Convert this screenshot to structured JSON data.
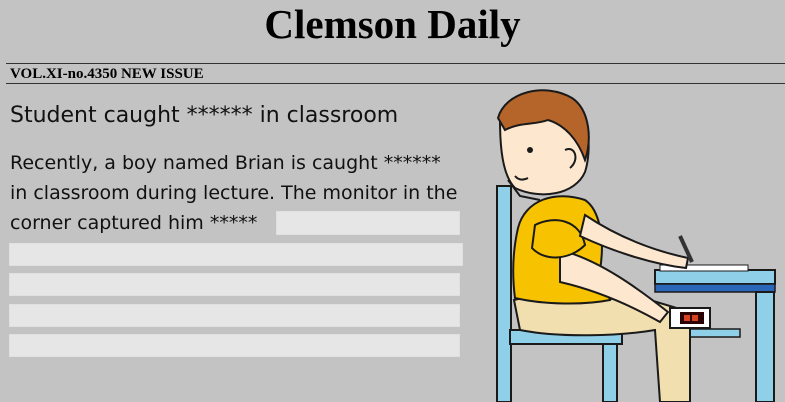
{
  "newspaper": {
    "title": "Clemson Daily",
    "issue_line": "VOL.XI-no.4350 NEW ISSUE"
  },
  "article": {
    "headline": "Student caught ****** in classroom",
    "body_lines": [
      "Recently, a boy named Brian is caught ******",
      "in classroom during lecture. The monitor in the",
      "corner captured him *****"
    ]
  },
  "blank_lines_count": 5,
  "colors": {
    "background": "#c3c3c3",
    "blank_fill": "#e6e6e6",
    "shirt": "#f7c300",
    "chair_desk": "#8fd0e8"
  },
  "illustration": {
    "subject": "boy-at-desk",
    "icons": [
      "monitor-device-icon",
      "pencil-icon"
    ]
  }
}
